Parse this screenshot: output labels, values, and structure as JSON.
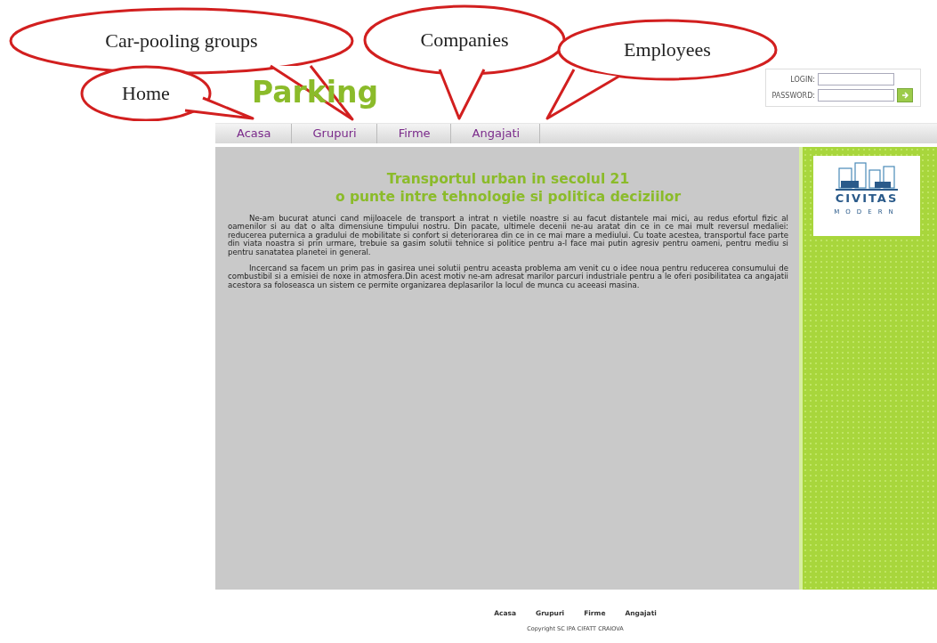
{
  "callouts": [
    {
      "label": "Car-pooling groups"
    },
    {
      "label": "Companies"
    },
    {
      "label": "Employees"
    },
    {
      "label": "Home"
    }
  ],
  "header": {
    "title": "Parking",
    "login": {
      "username_label": "LOGIN:",
      "password_label": "PASSWORD:"
    }
  },
  "nav": [
    "Acasa",
    "Grupuri",
    "Firme",
    "Angajati"
  ],
  "article": {
    "heading": [
      "Transportul urban in secolul 21",
      "o punte intre tehnologie si politica deciziilor"
    ],
    "paragraphs": [
      "Ne-am bucurat atunci cand mijloacele de transport a intrat n vietile noastre si au facut distantele mai mici, au redus efortul fizic al oamenilor si au dat o alta dimensiune timpului nostru. Din pacate, ultimele decenii ne-au aratat din ce in ce mai mult reversul medaliei: reducerea puternica a gradului de mobilitate si confort si deteriorarea din ce in ce mai mare a mediului. Cu toate acestea, transportul face parte din viata noastra si prin urmare, trebuie sa gasim solutii tehnice si politice pentru a-l face mai putin agresiv pentru oameni, pentru mediu si pentru sanatatea planetei in general.",
      "Incercand sa facem un prim pas in gasirea unei solutii pentru aceasta problema am venit cu o idee noua pentru reducerea consumului de combustibil si a emisiei de noxe in atmosfera.Din acest motiv ne-am adresat marilor parcuri industriale pentru a le oferi posibilitatea ca angajatii acestora sa foloseasca un sistem ce permite organizarea deplasarilor la locul de munca cu aceeasi masina."
    ]
  },
  "sidebar": {
    "logo": {
      "name": "CIVITAS",
      "subtitle": "MODERN"
    }
  },
  "footer": {
    "links": [
      "Acasa",
      "Grupuri",
      "Firme",
      "Angajati"
    ],
    "copyright": "Copyright SC IPA CIFATT CRAIOVA"
  }
}
